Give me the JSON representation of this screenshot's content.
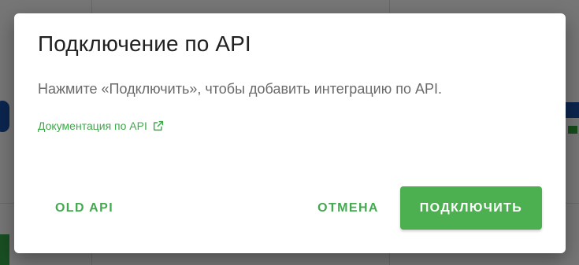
{
  "dialog": {
    "title": "Подключение по API",
    "text": "Нажмите «Подключить», чтобы добавить интеграцию по API.",
    "doc_link": {
      "label": "Документация по API",
      "icon": "external-link-icon"
    },
    "buttons": {
      "old_api": "OLD API",
      "cancel": "ОТМЕНА",
      "connect": "ПОДКЛЮЧИТЬ"
    }
  },
  "colors": {
    "accent": "#4caf50",
    "link": "#3ea84a",
    "title": "#212121",
    "text": "#6a6a6a"
  }
}
